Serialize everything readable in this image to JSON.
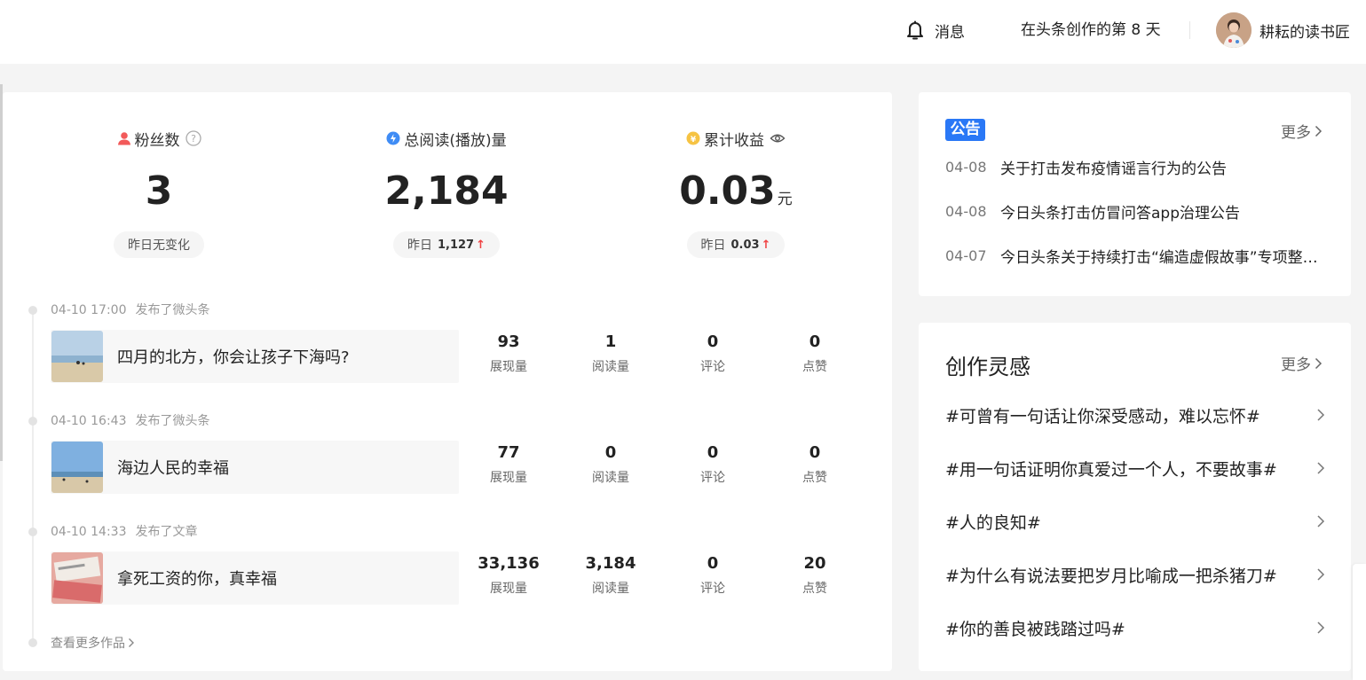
{
  "header": {
    "messages_label": "消息",
    "creation_days": "在头条创作的第 8 天",
    "username": "耕耘的读书匠"
  },
  "stats": {
    "fans": {
      "label": "粉丝数",
      "value": "3",
      "change": "昨日无变化"
    },
    "reads": {
      "label": "总阅读(播放)量",
      "value": "2,184",
      "change_prefix": "昨日",
      "change_value": "1,127",
      "change_arrow": "↑"
    },
    "income": {
      "label": "累计收益",
      "value": "0.03",
      "unit": "元",
      "change_prefix": "昨日",
      "change_value": "0.03",
      "change_arrow": "↑"
    }
  },
  "works": [
    {
      "time": "04-10 17:00",
      "action": "发布了微头条",
      "title": "四月的北方，你会让孩子下海吗?",
      "metrics": [
        {
          "value": "93",
          "label": "展现量"
        },
        {
          "value": "1",
          "label": "阅读量"
        },
        {
          "value": "0",
          "label": "评论"
        },
        {
          "value": "0",
          "label": "点赞"
        }
      ]
    },
    {
      "time": "04-10 16:43",
      "action": "发布了微头条",
      "title": "海边人民的幸福",
      "metrics": [
        {
          "value": "77",
          "label": "展现量"
        },
        {
          "value": "0",
          "label": "阅读量"
        },
        {
          "value": "0",
          "label": "评论"
        },
        {
          "value": "0",
          "label": "点赞"
        }
      ]
    },
    {
      "time": "04-10 14:33",
      "action": "发布了文章",
      "title": "拿死工资的你，真幸福",
      "metrics": [
        {
          "value": "33,136",
          "label": "展现量"
        },
        {
          "value": "3,184",
          "label": "阅读量"
        },
        {
          "value": "0",
          "label": "评论"
        },
        {
          "value": "20",
          "label": "点赞"
        }
      ]
    }
  ],
  "more_works": "查看更多作品",
  "notice": {
    "badge": "公告",
    "more": "更多",
    "items": [
      {
        "date": "04-08",
        "title": "关于打击发布疫情谣言行为的公告"
      },
      {
        "date": "04-08",
        "title": "今日头条打击仿冒问答app治理公告"
      },
      {
        "date": "04-07",
        "title": "今日头条关于持续打击“编造虚假故事”专项整…"
      }
    ]
  },
  "inspiration": {
    "title": "创作灵感",
    "more": "更多",
    "topics": [
      "#可曾有一句话让你深受感动，难以忘怀#",
      "#用一句话证明你真爱过一个人，不要故事#",
      "#人的良知#",
      "#为什么有说法要把岁月比喻成一把杀猪刀#",
      "#你的善良被践踏过吗#"
    ]
  },
  "colors": {
    "accent": "#2a78f6",
    "up_red": "#f04142",
    "fans_icon": "#f25a5a",
    "read_icon": "#3f8cf5",
    "income_icon": "#f6c343"
  },
  "icons": {
    "messages": "bell-icon",
    "help": "question-icon",
    "visibility": "eye-icon",
    "chevron": "chevron-right-icon"
  }
}
